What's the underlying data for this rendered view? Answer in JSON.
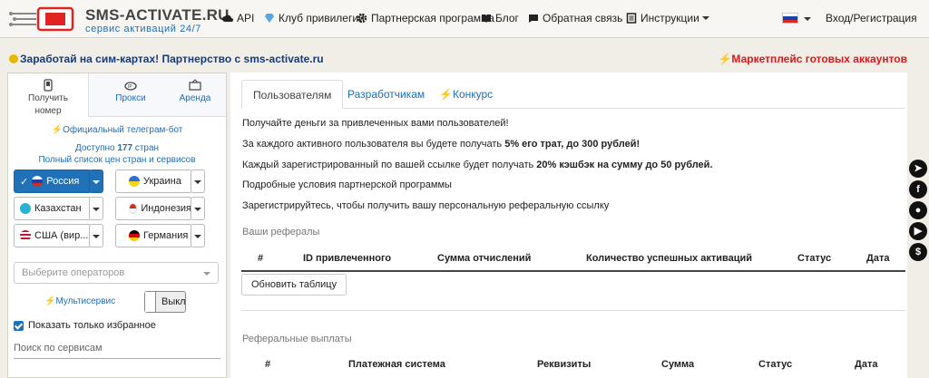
{
  "header": {
    "brand": "SMS-ACTIVATE.RU",
    "slogan": "сервис активаций 24/7",
    "nav": [
      {
        "label": "API",
        "icon": "cloud-icon"
      },
      {
        "label": "Клуб привилегий",
        "icon": "diamond-icon"
      },
      {
        "label": "Партнерская программа",
        "icon": "gear-icon"
      },
      {
        "label": "Блог",
        "icon": "book-icon"
      },
      {
        "label": "Обратная связь",
        "icon": "chat-icon"
      },
      {
        "label": "Инструкции",
        "icon": "document-icon"
      }
    ],
    "login": "Вход/Регистрация"
  },
  "promo": {
    "left": "Заработай на сим-картах! Партнерство с sms-activate.ru",
    "right": "Маркетплейс готовых аккаунтов"
  },
  "sidebar": {
    "tabs": [
      {
        "label_line1": "Получить",
        "label_line2": "номер"
      },
      {
        "label": "Прокси"
      },
      {
        "label": "Аренда"
      }
    ],
    "telegram_bot": "Официальный телеграм-бот",
    "available_prefix": "Доступно",
    "available_count": "177",
    "available_suffix": "стран",
    "full_list": "Полный список цен стран и сервисов",
    "countries": [
      {
        "name": "Россия",
        "selected": true
      },
      {
        "name": "Украина"
      },
      {
        "name": "Казахстан"
      },
      {
        "name": "Индонезия"
      },
      {
        "name": "США (вир..."
      },
      {
        "name": "Германия"
      }
    ],
    "operators_placeholder": "Выберите операторов",
    "multiservice": "Мультисервис",
    "toggle_label": "Выкл",
    "show_favorites": "Показать только избранное",
    "search_placeholder": "Поиск по сервисам"
  },
  "main": {
    "tabs": [
      "Пользователям",
      "Разработчикам",
      "Конкурс"
    ],
    "line1": "Получайте деньги за привлеченных вами пользователей!",
    "line2_a": "За каждого активного пользователя вы будете получать ",
    "line2_b": "5% его трат, до 300 рублей!",
    "line3_a": "Каждый зарегистрированный по вашей ссылке будет получать ",
    "line3_b": "20% кэшбэк на сумму до 50 рублей.",
    "conditions_link": "Подробные условия партнерской программы",
    "register_note": "Зарегистрируйтесь, чтобы получить вашу персональную реферальную ссылку",
    "referrals_title": "Ваши рефералы",
    "referrals_columns": [
      "#",
      "ID привлеченного",
      "Сумма отчислений",
      "Количество успешных активаций",
      "Статус",
      "Дата"
    ],
    "refresh_button": "Обновить таблицу",
    "payouts_title": "Реферальные выплаты",
    "payouts_columns": [
      "#",
      "Платежная система",
      "Реквизиты",
      "Сумма",
      "Статус",
      "Дата"
    ]
  },
  "colors": {
    "accent": "#1f72b8",
    "link": "#1f6db5",
    "promo_red": "#d61a1a"
  },
  "social": [
    "telegram-icon",
    "facebook-icon",
    "wechat-icon",
    "youtube-icon",
    "dollar-icon"
  ]
}
